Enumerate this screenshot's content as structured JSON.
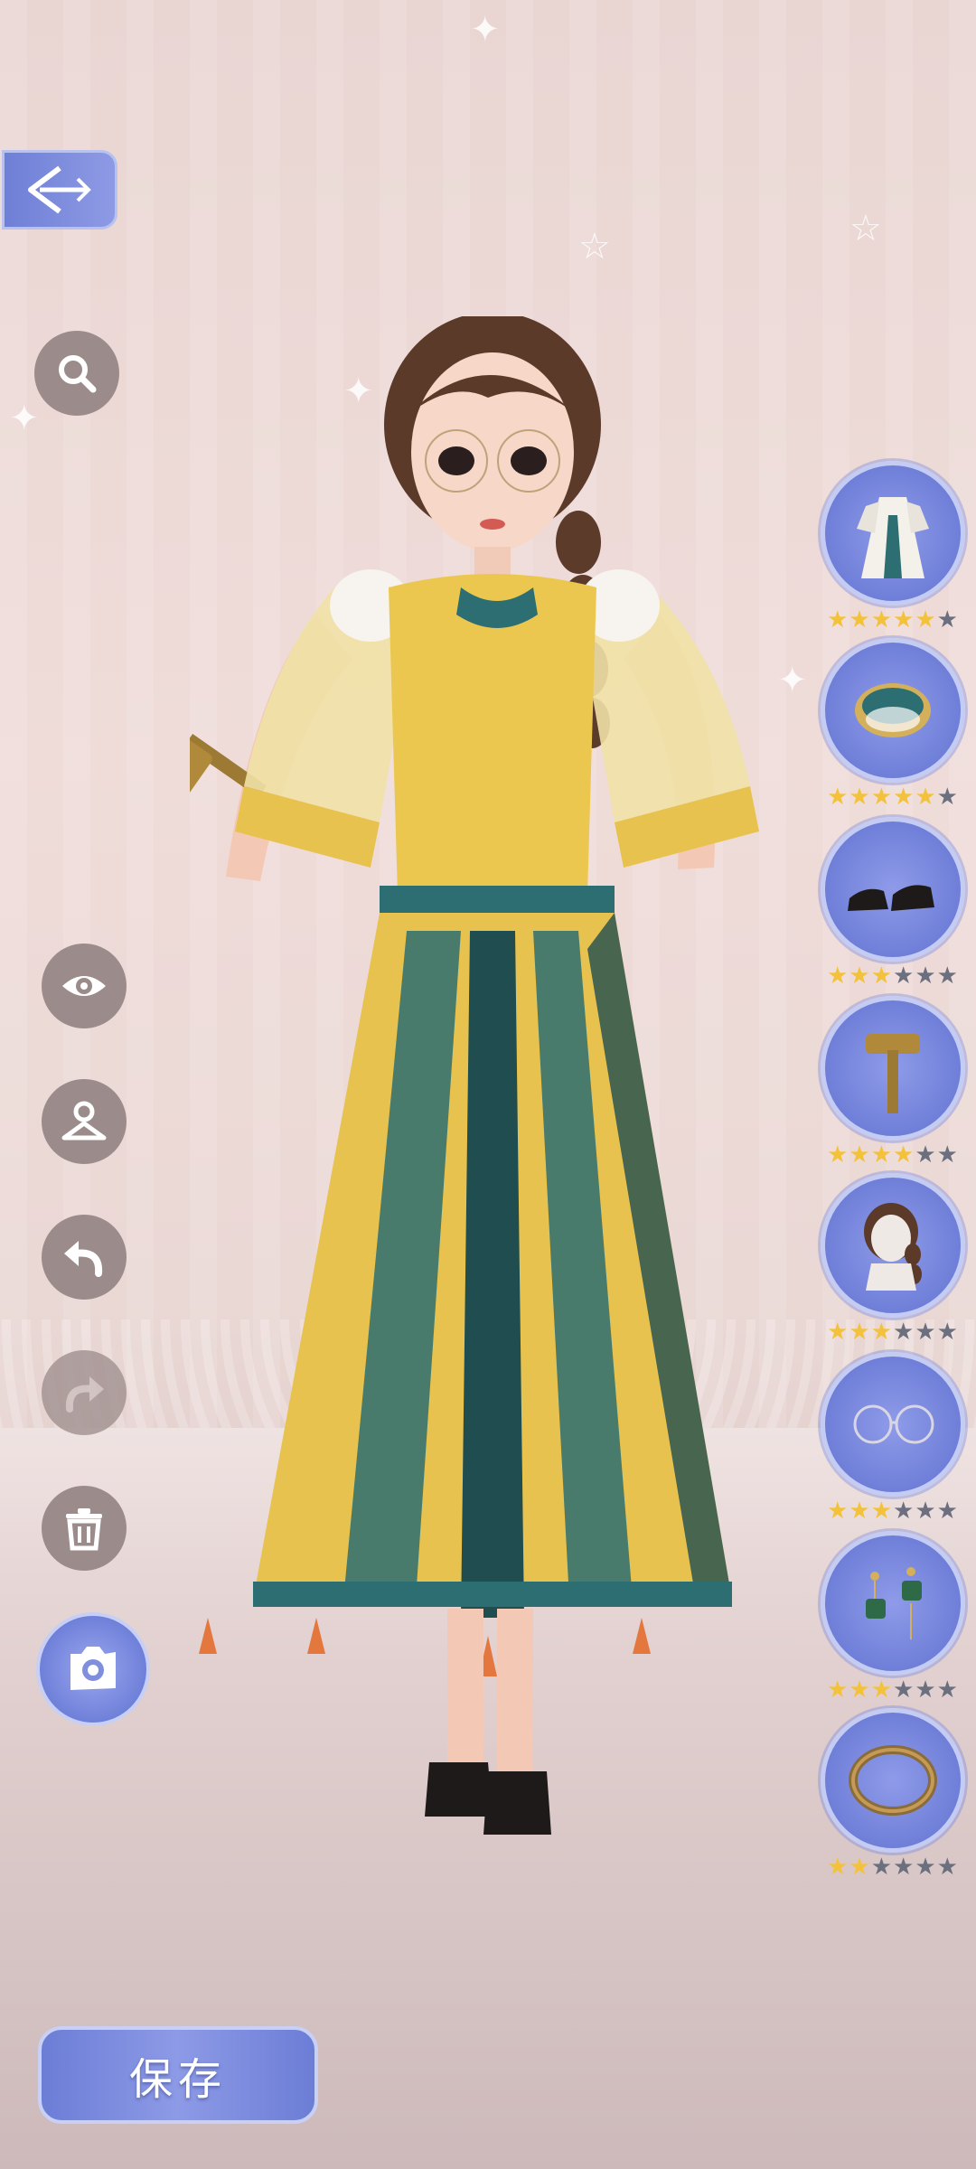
{
  "toolbar": {
    "back_icon": "back-arrow-icon",
    "search_icon": "search-icon",
    "eye_icon": "eye-icon",
    "hanger_icon": "hanger-icon",
    "undo_icon": "undo-icon",
    "redo_icon": "redo-icon",
    "delete_icon": "trash-icon",
    "camera_icon": "camera-icon"
  },
  "save": {
    "label": "保存"
  },
  "items": [
    {
      "icon": "dress-icon",
      "stars": 5,
      "max": 6
    },
    {
      "icon": "bracelet-icon",
      "stars": 5,
      "max": 6
    },
    {
      "icon": "shoes-icon",
      "stars": 3,
      "max": 6
    },
    {
      "icon": "hammer-icon",
      "stars": 4,
      "max": 6
    },
    {
      "icon": "hair-icon",
      "stars": 3,
      "max": 6
    },
    {
      "icon": "glasses-icon",
      "stars": 3,
      "max": 6
    },
    {
      "icon": "earrings-icon",
      "stars": 3,
      "max": 6
    },
    {
      "icon": "ring-bracelet-icon",
      "stars": 2,
      "max": 6
    }
  ],
  "colors": {
    "accent": "#6f80d9",
    "star_on": "#f3c23a",
    "star_off": "#6b6f7e",
    "dress_yellow": "#e8c24f",
    "dress_teal": "#2d6e72"
  }
}
